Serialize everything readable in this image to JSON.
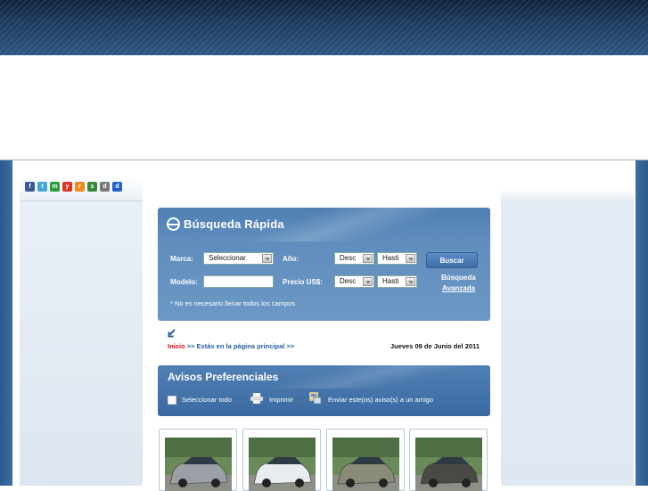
{
  "colors": {
    "header_dark": "#10213a",
    "panel_blue": "#5f8dbd",
    "link_blue": "#2a5ea0",
    "home_red": "#dd1111"
  },
  "social_icons": [
    {
      "name": "facebook-icon",
      "glyph": "f",
      "color": "#3b5998"
    },
    {
      "name": "twitter-icon",
      "glyph": "t",
      "color": "#41a6d8"
    },
    {
      "name": "messenger-icon",
      "glyph": "m",
      "color": "#2d9a3a"
    },
    {
      "name": "youtube-icon",
      "glyph": "y",
      "color": "#d32"
    },
    {
      "name": "rss-icon",
      "glyph": "r",
      "color": "#f08a1c"
    },
    {
      "name": "share-icon",
      "glyph": "s",
      "color": "#3a8a3a"
    },
    {
      "name": "digg-icon",
      "glyph": "d",
      "color": "#7a7a7a"
    },
    {
      "name": "delicious-icon",
      "glyph": "d",
      "color": "#2563c8"
    }
  ],
  "search": {
    "title": "Búsqueda Rápida",
    "marca_label": "Marca:",
    "marca_value": "Seleccionar",
    "anio_label": "Año:",
    "anio_from": "Desc",
    "anio_to": "Hasti",
    "modelo_label": "Modelo:",
    "modelo_value": "",
    "precio_label": "Precio US$:",
    "precio_from": "Desc",
    "precio_to": "Hasti",
    "buscar_button": "Buscar",
    "advanced_line1": "Búsqueda",
    "advanced_line2": "Avanzada",
    "note": "* No es necesario llenar todos los campos"
  },
  "breadcrumb": {
    "home": "Inicio",
    "separator1": ">>",
    "current": "Estás en la página principal",
    "separator2": ">>",
    "date": "Jueves 09 de Junio del 2011"
  },
  "avisos": {
    "title": "Avisos Preferenciales",
    "select_all": "Seleccionar todo",
    "print": "Imprimir",
    "send": "Enviar este(os) aviso(s) a un amigo"
  },
  "cars": [
    {
      "name": "car-thumbnail-1",
      "body": "#9aa0a6"
    },
    {
      "name": "car-thumbnail-2",
      "body": "#e9ecef"
    },
    {
      "name": "car-thumbnail-3",
      "body": "#8a8a78"
    },
    {
      "name": "car-thumbnail-4",
      "body": "#4a4a44"
    }
  ]
}
